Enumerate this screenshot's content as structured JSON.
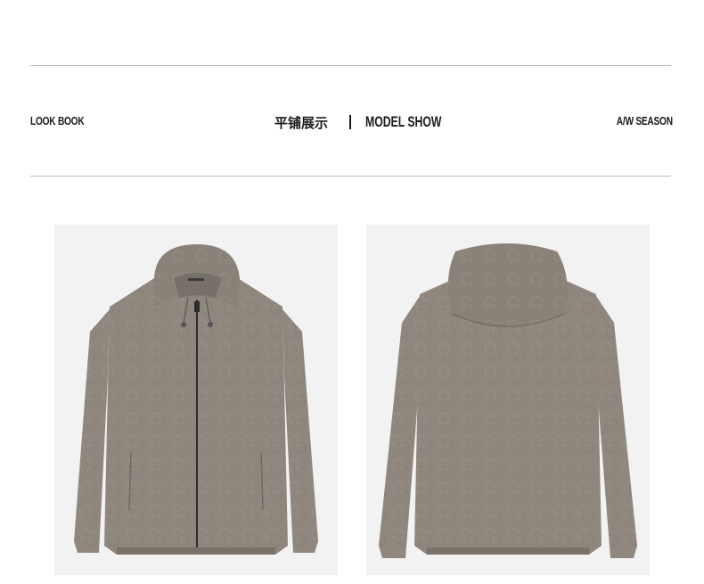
{
  "header": {
    "left_label": "LOOK BOOK",
    "title_cn": "平铺展示",
    "separator": "|",
    "title_en": "MODEL SHOW",
    "right_label": "A/W SEASON"
  },
  "images": [
    {
      "name": "jacket-front-image",
      "view": "front"
    },
    {
      "name": "jacket-back-image",
      "view": "back"
    }
  ],
  "colors": {
    "background": "#ffffff",
    "rule": "#bdbdbd",
    "photo_bg": "#f2f2f2",
    "jacket": "#8f877d",
    "jacket_shadow": "#7a7269",
    "zipper": "#2b2b2b"
  }
}
